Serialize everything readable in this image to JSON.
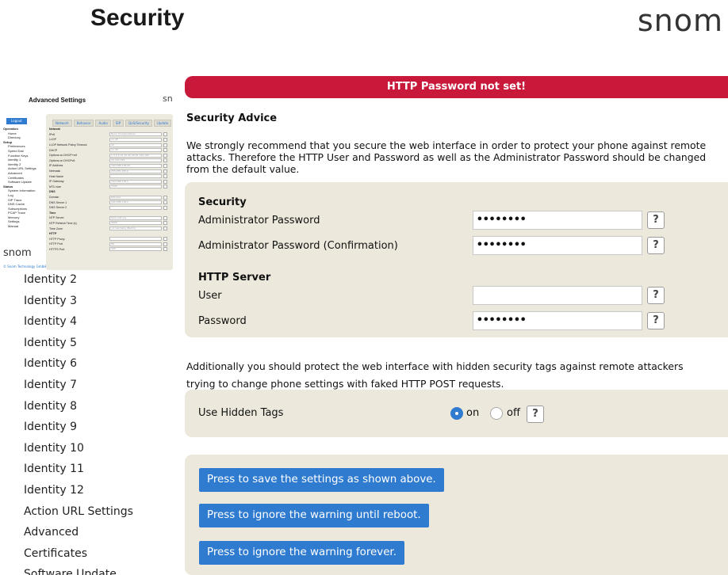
{
  "header": {
    "title": "Security",
    "logo": "snom"
  },
  "thumbnail": {
    "title": "Advanced Settings",
    "logo": "sn",
    "logout": "Logout",
    "brand": "snom",
    "copyright": "© Snom Technology GmbH",
    "tabs": [
      "Network",
      "Behavior",
      "Audio",
      "SIP",
      "QoS/Security",
      "Update"
    ],
    "nav": [
      {
        "t": "Operation",
        "s": true
      },
      {
        "t": "Home"
      },
      {
        "t": "Directory"
      },
      {
        "t": "Setup",
        "s": true
      },
      {
        "t": "Preferences"
      },
      {
        "t": "Speed Dial"
      },
      {
        "t": "Function Keys"
      },
      {
        "t": "Identity 1"
      },
      {
        "t": "Identity 2"
      },
      {
        "t": "Action URL Settings"
      },
      {
        "t": "Advanced"
      },
      {
        "t": "Certificates"
      },
      {
        "t": "Software Update"
      },
      {
        "t": "Status",
        "s": true
      },
      {
        "t": "System Information"
      },
      {
        "t": "Log"
      },
      {
        "t": "SIP Trace"
      },
      {
        "t": "DNS Cache"
      },
      {
        "t": "Subscriptions"
      },
      {
        "t": "PCAP Trace"
      },
      {
        "t": "Memory"
      },
      {
        "t": "Settings"
      },
      {
        "t": "Manual"
      }
    ],
    "rows": [
      {
        "l": "Network",
        "h": true
      },
      {
        "l": "IPv6",
        "v": "None (Conservative)"
      },
      {
        "l": "LLDP",
        "v": "on  off"
      },
      {
        "l": "LLDP Network Policy Timeout",
        "v": "30"
      },
      {
        "l": "DHCP",
        "v": "on  off"
      },
      {
        "l": "Options on DHCP+ref",
        "v": "1 3 4 6 12 15 42 43 55 120 125"
      },
      {
        "l": "Options on DHCPv6",
        "v": "23 100 135"
      },
      {
        "l": "IP Address",
        "v": "192.168.178.20"
      },
      {
        "l": "Netmask",
        "v": "255.255.255.0"
      },
      {
        "l": "Host Name",
        "v": ""
      },
      {
        "l": "IP Gateway",
        "v": "192.168.178.1"
      },
      {
        "l": "MTU size",
        "v": "1500"
      },
      {
        "l": "DNS",
        "h": true
      },
      {
        "l": "Domain",
        "v": "fritz.box"
      },
      {
        "l": "DNS Server 1",
        "v": "192.168.178.1"
      },
      {
        "l": "DNS Server 2",
        "v": ""
      },
      {
        "l": "Time",
        "h": true
      },
      {
        "l": "NTP Server",
        "v": "time.nist.org"
      },
      {
        "l": "NTP Refresh Time (s)",
        "v": "3600"
      },
      {
        "l": "Time Zone",
        "v": "+1 Germany (Berlin)"
      },
      {
        "l": "HTTP",
        "h": true
      },
      {
        "l": "HTTP Proxy",
        "v": ""
      },
      {
        "l": "HTTP Port",
        "v": "80"
      },
      {
        "l": "HTTPS Port",
        "v": "443"
      }
    ]
  },
  "sidebar": {
    "items": [
      "Identity 2",
      "Identity 3",
      "Identity 4",
      "Identity 5",
      "Identity 6",
      "Identity 7",
      "Identity 8",
      "Identity 9",
      "Identity 10",
      "Identity 11",
      "Identity 12",
      "Action URL Settings",
      "Advanced",
      "Certificates",
      "Software Update"
    ]
  },
  "banner": "HTTP Password not set!",
  "advice": {
    "title": "Security Advice",
    "text": "We strongly recommend that you secure the web interface in order to protect your phone against remote attacks. Therefore the HTTP User and Password as well as the Administrator Password should be changed from the default value."
  },
  "security": {
    "heading": "Security",
    "admin_label": "Administrator Password",
    "admin_value": "••••••••",
    "admin_confirm_label": "Administrator Password (Confirmation)",
    "admin_confirm_value": "••••••••",
    "help": "?"
  },
  "http": {
    "heading": "HTTP Server",
    "user_label": "User",
    "user_value": "",
    "password_label": "Password",
    "password_value": "••••••••"
  },
  "additional": {
    "line1": "Additionally you should protect the web interface with hidden security tags against remote attackers",
    "line2": "trying to change phone settings with faked HTTP POST requests."
  },
  "hidden_tags": {
    "label": "Use Hidden Tags",
    "on": "on",
    "off": "off",
    "selected": "on"
  },
  "buttons": {
    "save": "Press to save the settings as shown above.",
    "ignore_reboot": "Press to ignore the warning until reboot.",
    "ignore_forever": "Press to ignore the warning forever."
  },
  "colors": {
    "banner": "#c8193a",
    "accent": "#2f7bd0",
    "panel": "#ece9dc"
  }
}
